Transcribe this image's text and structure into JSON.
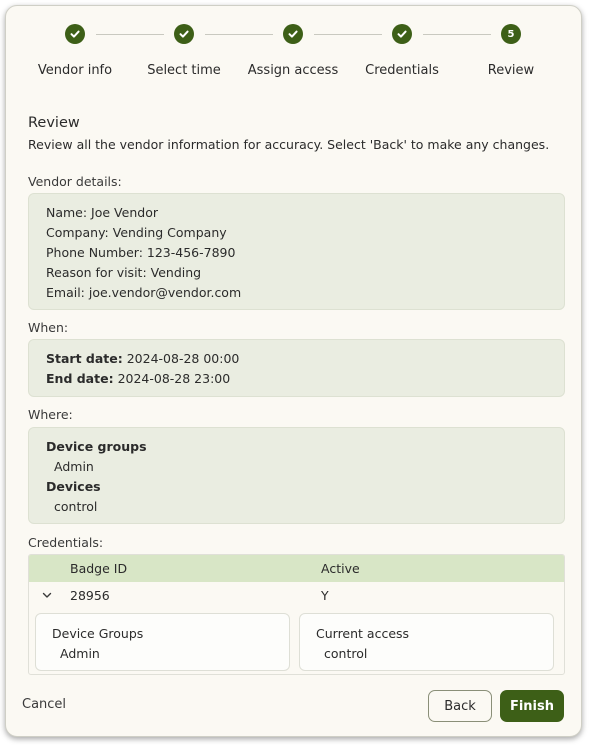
{
  "colors": {
    "accent": "#3d5f17",
    "panel": "#eaede1",
    "table_header": "#d8e6c6"
  },
  "stepper": {
    "steps": [
      {
        "label": "Vendor info",
        "state": "complete",
        "icon": "check-icon"
      },
      {
        "label": "Select time",
        "state": "complete",
        "icon": "check-icon"
      },
      {
        "label": "Assign access",
        "state": "complete",
        "icon": "check-icon"
      },
      {
        "label": "Credentials",
        "state": "complete",
        "icon": "check-icon"
      },
      {
        "label": "Review",
        "state": "current",
        "number": "5"
      }
    ]
  },
  "review": {
    "title": "Review",
    "subtitle": "Review all the vendor information for accuracy. Select 'Back' to make any changes."
  },
  "vendor": {
    "label": "Vendor details:",
    "name": "Name: Joe Vendor",
    "company": "Company: Vending Company",
    "phone": "Phone Number: 123-456-7890",
    "reason": "Reason for visit: Vending",
    "email": "Email: joe.vendor@vendor.com"
  },
  "when": {
    "label": "When:",
    "start_label": "Start date:",
    "start_value": "2024-08-28 00:00",
    "end_label": "End date:",
    "end_value": "2024-08-28 23:00"
  },
  "where": {
    "label": "Where:",
    "device_groups_label": "Device groups",
    "device_groups_value": "Admin",
    "devices_label": "Devices",
    "devices_value": "control"
  },
  "credentials": {
    "label": "Credentials:",
    "columns": [
      "Badge ID",
      "Active"
    ],
    "rows": [
      {
        "badge_id": "28956",
        "active": "Y"
      }
    ],
    "detail": {
      "device_groups_label": "Device Groups",
      "device_groups_value": "Admin",
      "current_access_label": "Current access",
      "current_access_value": "control"
    }
  },
  "footer": {
    "cancel": "Cancel",
    "back": "Back",
    "finish": "Finish"
  }
}
